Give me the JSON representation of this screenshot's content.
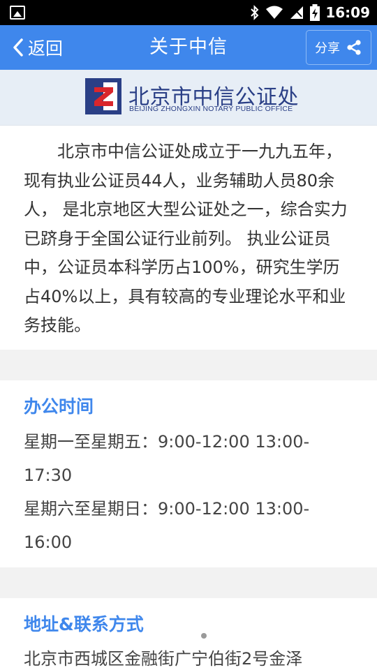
{
  "status_bar": {
    "time": "16:09",
    "icons": [
      "image-notification-icon",
      "bluetooth-icon",
      "wifi-icon",
      "cellular-icon",
      "battery-charging-icon"
    ]
  },
  "header": {
    "back_label": "返回",
    "title": "关于中信",
    "share_label": "分享",
    "background_color": "#3f87ec"
  },
  "brand": {
    "name_cn": "北京市中信公证处",
    "name_en": "BEIJING ZHONGXIN NOTARY PUBLIC OFFICE",
    "logo_letter": "Z"
  },
  "intro": {
    "text": "北京市中信公证处成立于一九九五年，现有执业公证员44人，业务辅助人员80余人， 是北京地区大型公证处之一，综合实力已跻身于全国公证行业前列。 执业公证员中，公证员本科学历占100%，研究生学历占40%以上，具有较高的专业理论水平和业务技能。"
  },
  "office_hours": {
    "title": "办公时间",
    "weekdays": "星期一至星期五：9:00-12:00 13:00-17:30",
    "weekends": "星期六至星期日：9:00-12:00 13:00-16:00"
  },
  "contact": {
    "title": "地址&联系方式",
    "address": "北京市西城区金融街广宁伯街2号金泽"
  },
  "colors": {
    "accent": "#3f87ec",
    "logo_navy": "#2a3f86",
    "logo_red": "#d9262c"
  }
}
